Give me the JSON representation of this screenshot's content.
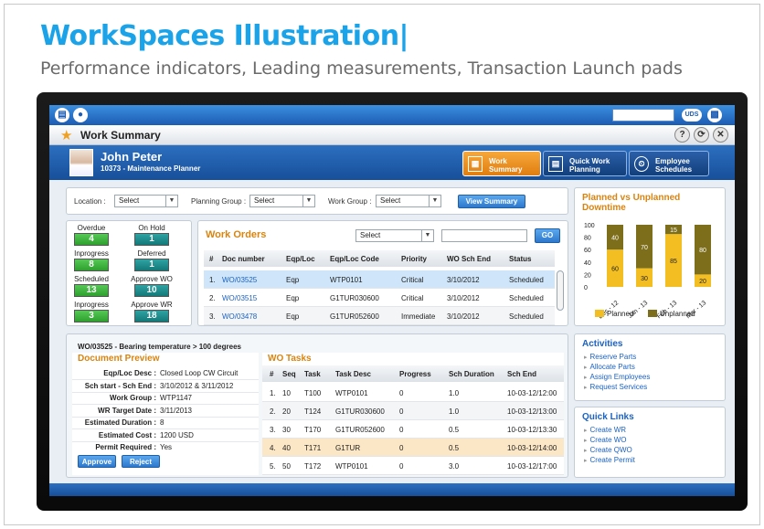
{
  "slide": {
    "title": "WorkSpaces Illustration|",
    "subtitle": "Performance indicators, Leading measurements, Transaction Launch pads"
  },
  "topbar": {
    "uds": "UDS"
  },
  "window": {
    "title": "Work Summary",
    "help": "?",
    "back": "⟳",
    "close": "✕"
  },
  "user": {
    "name": "John Peter",
    "role": "10373 - Maintenance Planner"
  },
  "tabs": [
    {
      "l1": "Work",
      "l2": "Summary",
      "icon": "▦"
    },
    {
      "l1": "Quick Work",
      "l2": "Planning",
      "icon": "▤"
    },
    {
      "l1": "Employee",
      "l2": "Schedules",
      "icon": "⏲"
    }
  ],
  "filters": {
    "location_label": "Location :",
    "location_value": "Select",
    "planning_label": "Planning Group :",
    "planning_value": "Select",
    "workgroup_label": "Work Group :",
    "workgroup_value": "Select",
    "view_button": "View Summary"
  },
  "kpis": [
    {
      "label": "Overdue",
      "value": "4",
      "color": "green"
    },
    {
      "label": "On Hold",
      "value": "1",
      "color": "teal"
    },
    {
      "label": "Inprogress",
      "value": "8",
      "color": "green"
    },
    {
      "label": "Deferred",
      "value": "1",
      "color": "teal"
    },
    {
      "label": "Scheduled",
      "value": "13",
      "color": "green"
    },
    {
      "label": "Approve WO",
      "value": "10",
      "color": "teal"
    },
    {
      "label": "Inprogress",
      "value": "3",
      "color": "green"
    },
    {
      "label": "Approve WR",
      "value": "18",
      "color": "teal"
    }
  ],
  "work_orders": {
    "title": "Work Orders",
    "select_value": "Select",
    "go": "GO",
    "headers": [
      "#",
      "Doc number",
      "Eqp/Loc",
      "Eqp/Loc Code",
      "Priority",
      "WO Sch End",
      "Status"
    ],
    "rows": [
      [
        "1.",
        "WO/03525",
        "Eqp",
        "WTP0101",
        "Critical",
        "3/10/2012",
        "Scheduled"
      ],
      [
        "2.",
        "WO/03515",
        "Eqp",
        "G1TUR030600",
        "Critical",
        "3/10/2012",
        "Scheduled"
      ],
      [
        "3.",
        "WO/03478",
        "Eqp",
        "G1TUR052600",
        "Immediate",
        "3/10/2012",
        "Scheduled"
      ]
    ]
  },
  "chart_data": {
    "type": "bar",
    "title": "Planned vs Unplanned Downtime",
    "categories": [
      "Dec - 12",
      "Jan - 13",
      "Feb - 13",
      "Mar - 13"
    ],
    "series": [
      {
        "name": "Planned",
        "values": [
          60,
          30,
          85,
          20
        ]
      },
      {
        "name": "Unplanned",
        "values": [
          40,
          70,
          15,
          80
        ]
      }
    ],
    "data_labels": [
      [
        "60",
        "40"
      ],
      [
        "30",
        "70"
      ],
      [
        "85",
        "15"
      ],
      [
        "20",
        "80"
      ]
    ],
    "ylim": [
      0,
      100
    ],
    "yticks": [
      "100",
      "80",
      "60",
      "40",
      "20",
      "0"
    ],
    "stacked": true,
    "legend_position": "bottom",
    "colors": {
      "Planned": "#f2be22",
      "Unplanned": "#7d6e1c"
    }
  },
  "detail": {
    "header": "WO/03525 - Bearing temperature > 100 degrees",
    "preview_title": "Document Preview",
    "fields": [
      {
        "label": "Eqp/Loc Desc :",
        "value": "Closed Loop CW Circuit"
      },
      {
        "label": "Sch start - Sch End :",
        "value": "3/10/2012 & 3/11/2012"
      },
      {
        "label": "Work Group :",
        "value": "WTP1147"
      },
      {
        "label": "WR Target Date :",
        "value": "3/11/2013"
      },
      {
        "label": "Estimated Duration :",
        "value": "8"
      },
      {
        "label": "Estimated Cost :",
        "value": "1200 USD"
      },
      {
        "label": "Permit Required :",
        "value": "Yes"
      }
    ],
    "approve": "Approve",
    "reject": "Reject"
  },
  "tasks": {
    "title": "WO Tasks",
    "headers": [
      "#",
      "Seq",
      "Task",
      "Task Desc",
      "Progress",
      "Sch Duration",
      "Sch End"
    ],
    "rows": [
      [
        "1.",
        "10",
        "T100",
        "WTP0101",
        "0",
        "1.0",
        "10-03-12/12:00"
      ],
      [
        "2.",
        "20",
        "T124",
        "G1TUR030600",
        "0",
        "1.0",
        "10-03-12/13:00"
      ],
      [
        "3.",
        "30",
        "T170",
        "G1TUR052600",
        "0",
        "0.5",
        "10-03-12/13:30"
      ],
      [
        "4.",
        "40",
        "T171",
        "G1TUR",
        "0",
        "0.5",
        "10-03-12/14:00"
      ],
      [
        "5.",
        "50",
        "T172",
        "WTP0101",
        "0",
        "3.0",
        "10-03-12/17:00"
      ]
    ]
  },
  "activities": {
    "title": "Activities",
    "items": [
      "Reserve Parts",
      "Allocate Parts",
      "Assign Employees",
      "Request Services"
    ]
  },
  "quick_links": {
    "title": "Quick Links",
    "items": [
      "Create WR",
      "Create WO",
      "Create QWO",
      "Create Permit"
    ]
  }
}
